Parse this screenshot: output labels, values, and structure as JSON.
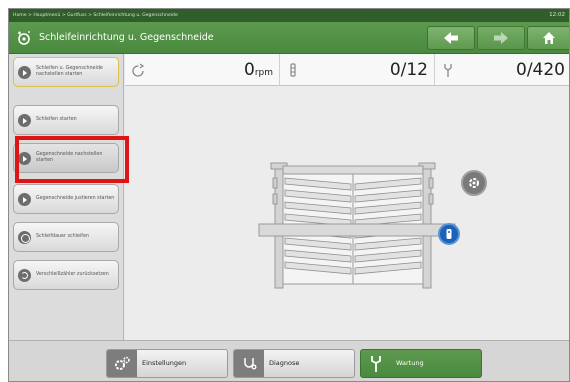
{
  "breadcrumb": "Home > Hauptmenü > Gurtfuss > Schleifeinrichtung u. Gegenschneide",
  "clock": "12:02",
  "header": {
    "title": "Schleifeinrichtung u. Gegenschneide"
  },
  "nav": {
    "back": "back-arrow",
    "forward": "forward-arrow",
    "home": "home-icon"
  },
  "sidebar": {
    "items": [
      {
        "label": "Schleifen u. Gegenschneide nachstellen starten",
        "icon": "play-icon"
      },
      {
        "label": "Schleifen starten",
        "icon": "play-icon"
      },
      {
        "label": "Gegenschneide nachstellen starten",
        "icon": "play-icon"
      },
      {
        "label": "Gegenschneide justieren starten",
        "icon": "play-icon"
      },
      {
        "label": "Schleifdauer schleifen",
        "icon": "disc-icon"
      },
      {
        "label": "Verschleißzähler zurücksetzen",
        "icon": "reset-icon"
      }
    ]
  },
  "counters": {
    "rpm": {
      "value": "0",
      "unit": "rpm"
    },
    "cycles": {
      "value": "0/12"
    },
    "total": {
      "value": "0/420"
    }
  },
  "bottom": {
    "settings_label": "Einstellungen",
    "diagnosis_label": "Diagnose",
    "maintenance_label": "Wartung"
  },
  "colors": {
    "brand_green": "#4a8a3e",
    "highlight_red": "#e01414",
    "info_blue": "#1a63b6"
  }
}
